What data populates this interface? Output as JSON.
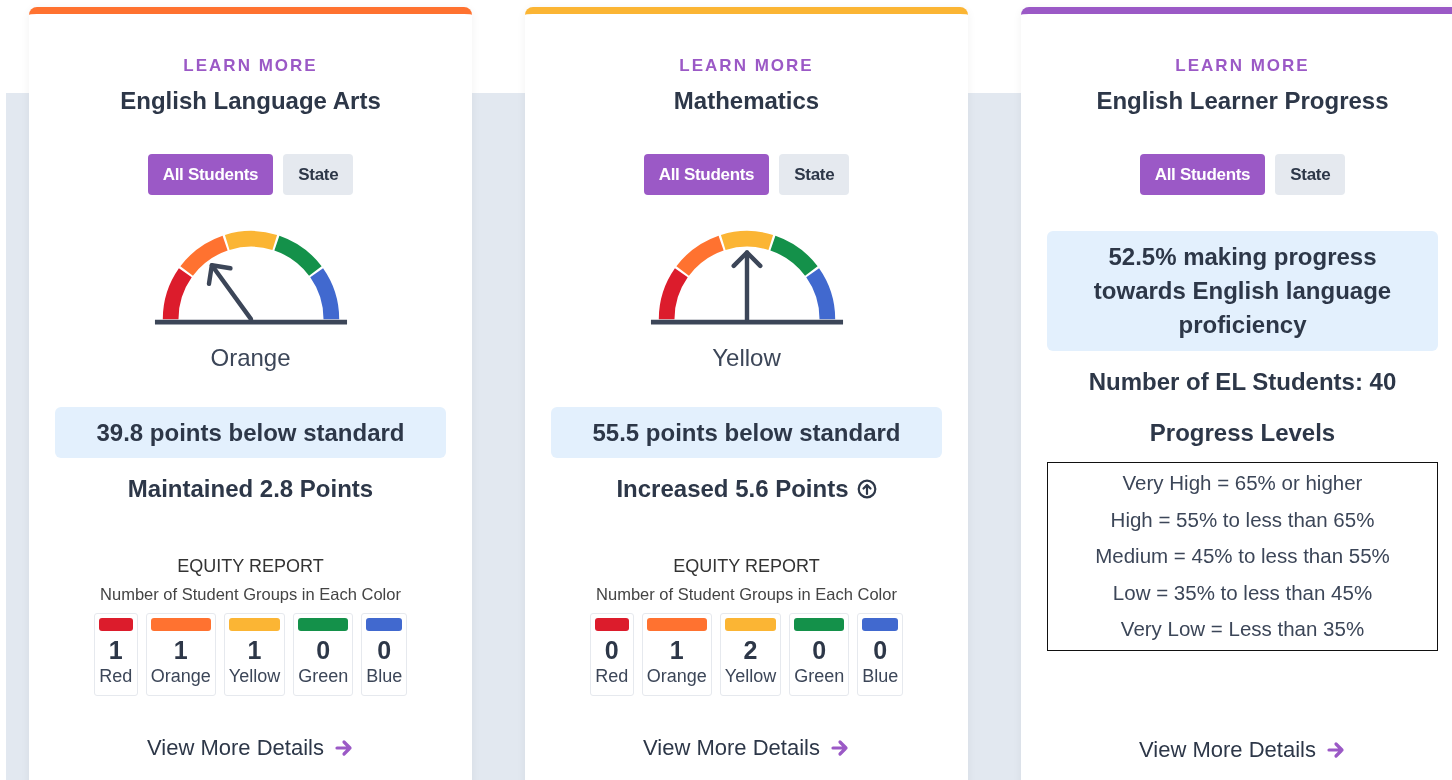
{
  "cards": [
    {
      "kind": "gauge",
      "color": "#ff7230",
      "eyebrow": "LEARN MORE",
      "title": "English Language Arts",
      "tabs": [
        {
          "label": "All Students",
          "selected": true
        },
        {
          "label": "State",
          "selected": false
        }
      ],
      "status": "Orange",
      "highlight": "39.8 points below standard",
      "change": "Maintained 2.8 Points",
      "equity": {
        "title": "EQUITY REPORT",
        "subtitle": "Number of Student Groups in Each Color",
        "groups": [
          {
            "color": "#dc1c2c",
            "count": "1",
            "label": "Red"
          },
          {
            "color": "#ff7230",
            "count": "1",
            "label": "Orange"
          },
          {
            "color": "#fbb534",
            "count": "1",
            "label": "Yellow"
          },
          {
            "color": "#14914a",
            "count": "0",
            "label": "Green"
          },
          {
            "color": "#4169cf",
            "count": "0",
            "label": "Blue"
          }
        ]
      },
      "link": "View More Details"
    },
    {
      "kind": "gauge",
      "color": "#fbb534",
      "eyebrow": "LEARN MORE",
      "title": "Mathematics",
      "tabs": [
        {
          "label": "All Students",
          "selected": true
        },
        {
          "label": "State",
          "selected": false
        }
      ],
      "status": "Yellow",
      "highlight": "55.5 points below standard",
      "change": "Increased 5.6 Points",
      "increased": true,
      "equity": {
        "title": "EQUITY REPORT",
        "subtitle": "Number of Student Groups in Each Color",
        "groups": [
          {
            "color": "#dc1c2c",
            "count": "0",
            "label": "Red"
          },
          {
            "color": "#ff7230",
            "count": "1",
            "label": "Orange"
          },
          {
            "color": "#fbb534",
            "count": "2",
            "label": "Yellow"
          },
          {
            "color": "#14914a",
            "count": "0",
            "label": "Green"
          },
          {
            "color": "#4169cf",
            "count": "0",
            "label": "Blue"
          }
        ]
      },
      "link": "View More Details"
    },
    {
      "kind": "progress",
      "color": "#9b59c6",
      "eyebrow": "LEARN MORE",
      "title": "English Learner Progress",
      "tabs": [
        {
          "label": "All Students",
          "selected": true
        },
        {
          "label": "State",
          "selected": false
        }
      ],
      "highlight": "52.5% making progress towards English language proficiency",
      "count": "Number of EL Students: 40",
      "levels_title": "Progress Levels",
      "levels": [
        "Very High = 65% or higher",
        "High = 55% to less than 65%",
        "Medium = 45% to less than 55%",
        "Low = 35% to less than 45%",
        "Very Low = Less than 35%"
      ],
      "link": "View More Details"
    }
  ]
}
